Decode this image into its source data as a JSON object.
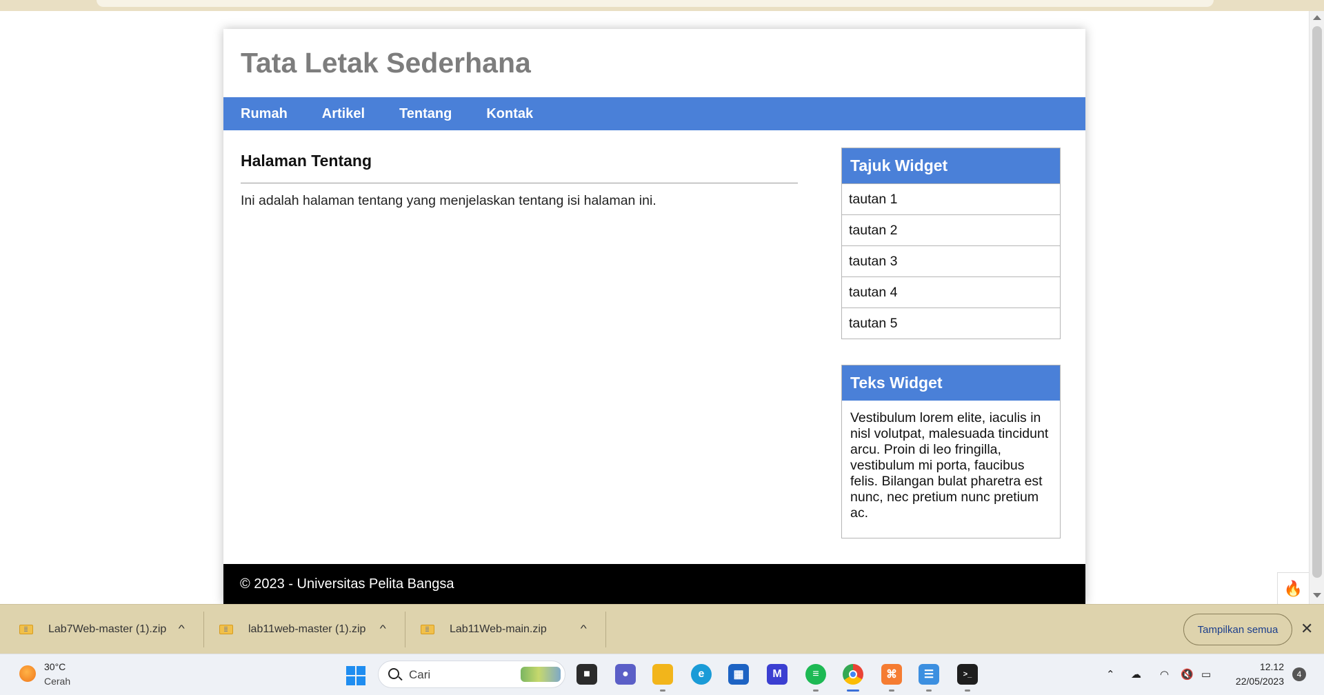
{
  "page": {
    "site_title": "Tata Letak Sederhana",
    "nav": [
      "Rumah",
      "Artikel",
      "Tentang",
      "Kontak"
    ],
    "content": {
      "title": "Halaman Tentang",
      "text": "Ini adalah halaman tentang yang menjelaskan tentang isi halaman ini."
    },
    "widget_links": {
      "title": "Tajuk Widget",
      "links": [
        "tautan 1",
        "tautan 2",
        "tautan 3",
        "tautan 4",
        "tautan 5"
      ]
    },
    "widget_text": {
      "title": "Teks Widget",
      "text": "Vestibulum lorem elite, iaculis in nisl volutpat, malesuada tincidunt arcu. Proin di leo fringilla, vestibulum mi porta, faucibus felis. Bilangan bulat pharetra est nunc, nec pretium nunc pretium ac."
    },
    "footer": "© 2023 - Universitas Pelita Bangsa"
  },
  "downloads": {
    "items": [
      "Lab7Web-master (1).zip",
      "lab11web-master (1).zip",
      "Lab11Web-main.zip"
    ],
    "show_all_label": "Tampilkan semua"
  },
  "taskbar": {
    "weather": {
      "temp": "30°C",
      "condition": "Cerah"
    },
    "search_placeholder": "Cari",
    "apps": [
      "file-explorer-icon",
      "teams-chat-icon",
      "folder-icon",
      "edge-icon",
      "store-icon",
      "vscode-like-icon",
      "spotify-icon",
      "chrome-icon",
      "xampp-icon",
      "notepad-icon",
      "terminal-icon"
    ],
    "clock": {
      "time": "12.12",
      "date": "22/05/2023"
    },
    "notification_count": "4"
  },
  "colors": {
    "accent": "#4a80d8",
    "footer_bg": "#000000",
    "title_gray": "#7d7d7d",
    "download_bar": "#ded3ad"
  }
}
